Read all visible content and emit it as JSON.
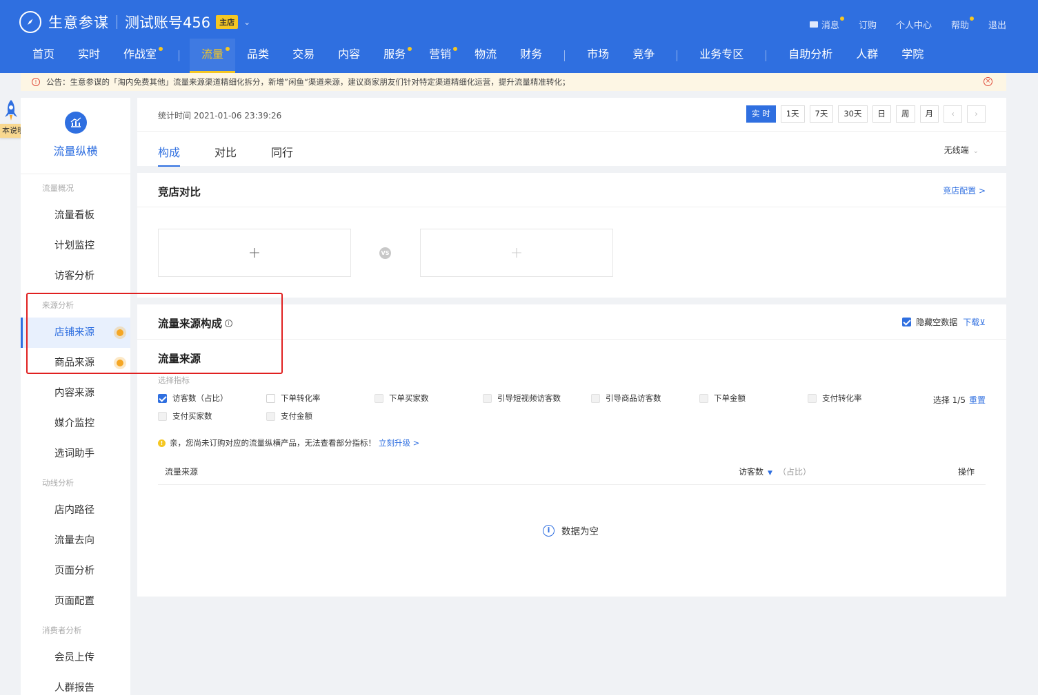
{
  "header": {
    "brand": "生意参谋",
    "account": "测试账号456",
    "shop_badge": "主店",
    "top_links": [
      "消息",
      "订购",
      "个人中心",
      "帮助",
      "退出"
    ],
    "nav": [
      "首页",
      "实时",
      "作战室",
      "流量",
      "品类",
      "交易",
      "内容",
      "服务",
      "营销",
      "物流",
      "财务",
      "市场",
      "竞争",
      "业务专区",
      "自助分析",
      "人群",
      "学院"
    ],
    "nav_active": "流量"
  },
  "notice": {
    "text": "公告：生意参谋的「淘内免费其他」流量来源渠道精细化拆分，新增”闲鱼“渠道来源，建议商家朋友们针对特定渠道精细化运营，提升流量精准转化；"
  },
  "doc_tag": "本说明",
  "sidebar": {
    "title": "流量纵横",
    "groups": [
      {
        "label": "流量概况",
        "items": [
          "流量看板",
          "计划监控",
          "访客分析"
        ]
      },
      {
        "label": "来源分析",
        "items": [
          "店铺来源",
          "商品来源",
          "内容来源",
          "媒介监控",
          "选词助手"
        ]
      },
      {
        "label": "动线分析",
        "items": [
          "店内路径",
          "流量去向",
          "页面分析",
          "页面配置"
        ]
      },
      {
        "label": "消费者分析",
        "items": [
          "会员上传",
          "人群报告"
        ]
      }
    ],
    "active_item": "店铺来源"
  },
  "toolbar": {
    "stat_time": "统计时间 2021-01-06 23:39:26",
    "time_buttons": [
      "实 时",
      "1天",
      "7天",
      "30天",
      "日",
      "周",
      "月"
    ],
    "active_time": "实 时",
    "tabs": [
      "构成",
      "对比",
      "同行"
    ],
    "active_tab": "构成",
    "device": "无线端"
  },
  "competitor": {
    "title": "竞店对比",
    "config_link": "竞店配置 >",
    "add_symbol": "+",
    "vs_label": "VS"
  },
  "composition": {
    "title": "流量来源构成",
    "hide_empty_label": "隐藏空数据",
    "hide_empty_checked": true,
    "download_label": "下载⊻",
    "subtitle": "流量来源",
    "pick_label": "选择指标",
    "metrics": [
      {
        "label": "访客数（占比）",
        "checked": true
      },
      {
        "label": "下单转化率",
        "checked": false
      },
      {
        "label": "下单买家数",
        "checked": false
      },
      {
        "label": "引导短视频访客数",
        "checked": false
      },
      {
        "label": "引导商品访客数",
        "checked": false
      },
      {
        "label": "下单金额",
        "checked": false
      },
      {
        "label": "支付转化率",
        "checked": false
      },
      {
        "label": "支付买家数",
        "checked": false
      },
      {
        "label": "支付金额",
        "checked": false
      }
    ],
    "selected_count": "选择 1/5",
    "reset_label": "重置",
    "warn_text": "亲，您尚未订购对应的流量纵横产品，无法查看部分指标！",
    "upgrade_link": "立刻升级 >",
    "table_headers": {
      "source": "流量来源",
      "visitors": "访客数",
      "ratio": "（占比）",
      "op": "操作"
    },
    "empty_text": "数据为空"
  }
}
